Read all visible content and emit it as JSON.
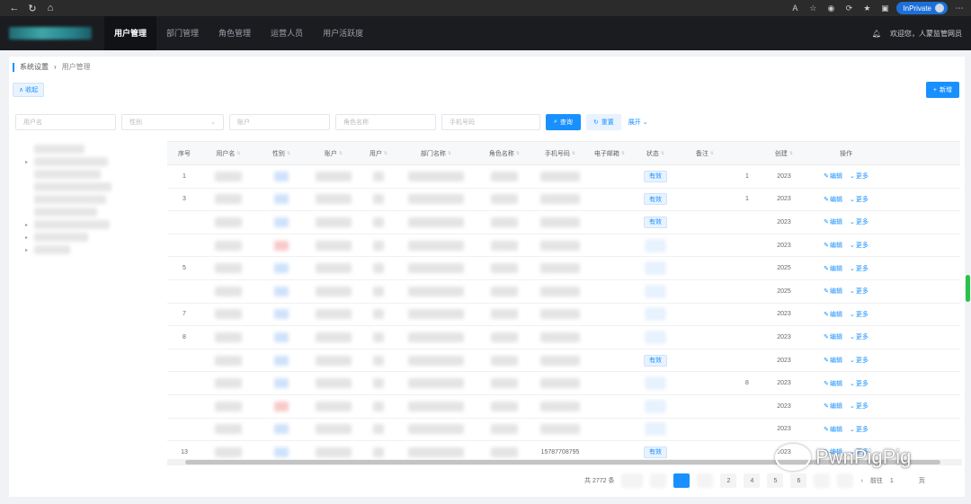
{
  "browser": {
    "inprivate_label": "InPrivate"
  },
  "header": {
    "nav": [
      "用户管理",
      "部门管理",
      "角色管理",
      "运营人员",
      "用户活跃度"
    ],
    "active_index": 0,
    "greeting": "欢迎您，人蒙监管网员"
  },
  "breadcrumb": {
    "root": "系统设置",
    "current": "用户管理"
  },
  "buttons": {
    "collapse": "收起",
    "add": "新增",
    "query": "查询",
    "reset": "重置",
    "expand": "展开"
  },
  "filters": [
    {
      "placeholder": "用户名"
    },
    {
      "placeholder": "性别",
      "type": "select"
    },
    {
      "placeholder": "账户"
    },
    {
      "placeholder": "角色名称"
    },
    {
      "placeholder": "手机号码"
    }
  ],
  "table": {
    "columns": [
      "序号",
      "用户名",
      "性别",
      "账户",
      "用户",
      "部门名称",
      "角色名称",
      "手机号码",
      "电子邮箱",
      "状态",
      "备注",
      "",
      "创建",
      "操作"
    ],
    "rows": [
      {
        "no": "1",
        "status": "有效",
        "date": "2023",
        "id_tail": "1"
      },
      {
        "no": "3",
        "status": "有效",
        "date": "2023",
        "id_tail": "1"
      },
      {
        "no": "",
        "status": "有效",
        "date": "2023",
        "id_tail": ""
      },
      {
        "no": "",
        "status": "",
        "date": "2023",
        "id_tail": ""
      },
      {
        "no": "5",
        "status": "",
        "date": "2025",
        "id_tail": ""
      },
      {
        "no": "",
        "status": "",
        "date": "2025",
        "id_tail": ""
      },
      {
        "no": "7",
        "status": "",
        "date": "2023",
        "id_tail": ""
      },
      {
        "no": "8",
        "status": "",
        "date": "2023",
        "id_tail": ""
      },
      {
        "no": "",
        "status": "有效",
        "date": "2023",
        "id_tail": ""
      },
      {
        "no": "",
        "status": "",
        "date": "2023",
        "id_tail": "8"
      },
      {
        "no": "",
        "status": "",
        "date": "2023",
        "id_tail": ""
      },
      {
        "no": "",
        "status": "",
        "date": "2023",
        "id_tail": ""
      },
      {
        "no": "13",
        "status": "有效",
        "date": "2023",
        "id_tail": "",
        "phone": "15787708795"
      }
    ],
    "edit_label": "编辑",
    "more_label": "更多"
  },
  "pagination": {
    "total_text": "共 2772 条",
    "pages": [
      "",
      "",
      "",
      "",
      "",
      "",
      "",
      "",
      "",
      ""
    ],
    "visible_pages": [
      "2",
      "4",
      "5",
      "6"
    ],
    "goto_label": "前往",
    "goto_value": "1",
    "page_suffix": "页"
  },
  "watermark": {
    "text": "PwnPigPig"
  },
  "colors": {
    "primary": "#1890ff",
    "header_bg": "#1a1c20",
    "scroll_thumb": "#2bc24a"
  }
}
